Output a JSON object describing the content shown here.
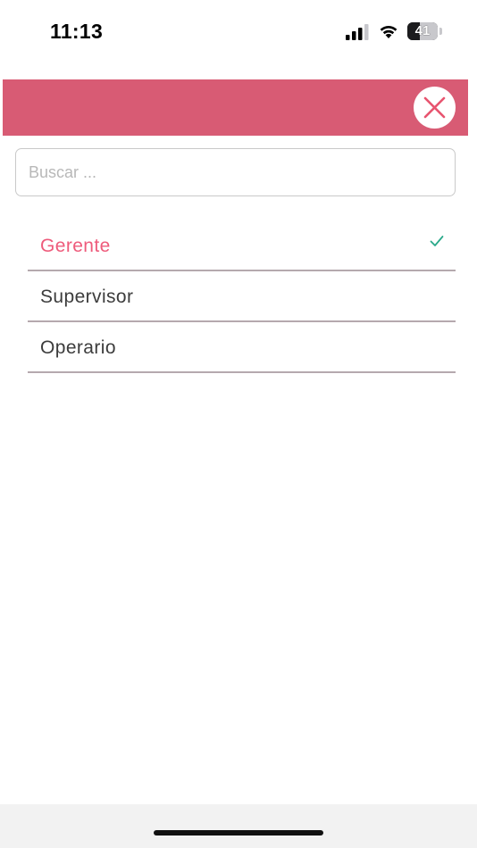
{
  "status_bar": {
    "time": "11:13",
    "battery_level": "41",
    "battery_fraction": 0.41,
    "icons": [
      "signal-icon",
      "wifi-icon",
      "battery-icon"
    ]
  },
  "header": {
    "background_color": "#d85b74",
    "close_icon": "close-icon",
    "close_icon_color": "#e8546f"
  },
  "search": {
    "placeholder": "Buscar ...",
    "value": ""
  },
  "options": [
    {
      "label": "Gerente",
      "selected": true
    },
    {
      "label": "Supervisor",
      "selected": false
    },
    {
      "label": "Operario",
      "selected": false
    }
  ],
  "colors": {
    "accent": "#ee5b7b",
    "check": "#2aa98a",
    "divider": "#b5a9ae"
  }
}
